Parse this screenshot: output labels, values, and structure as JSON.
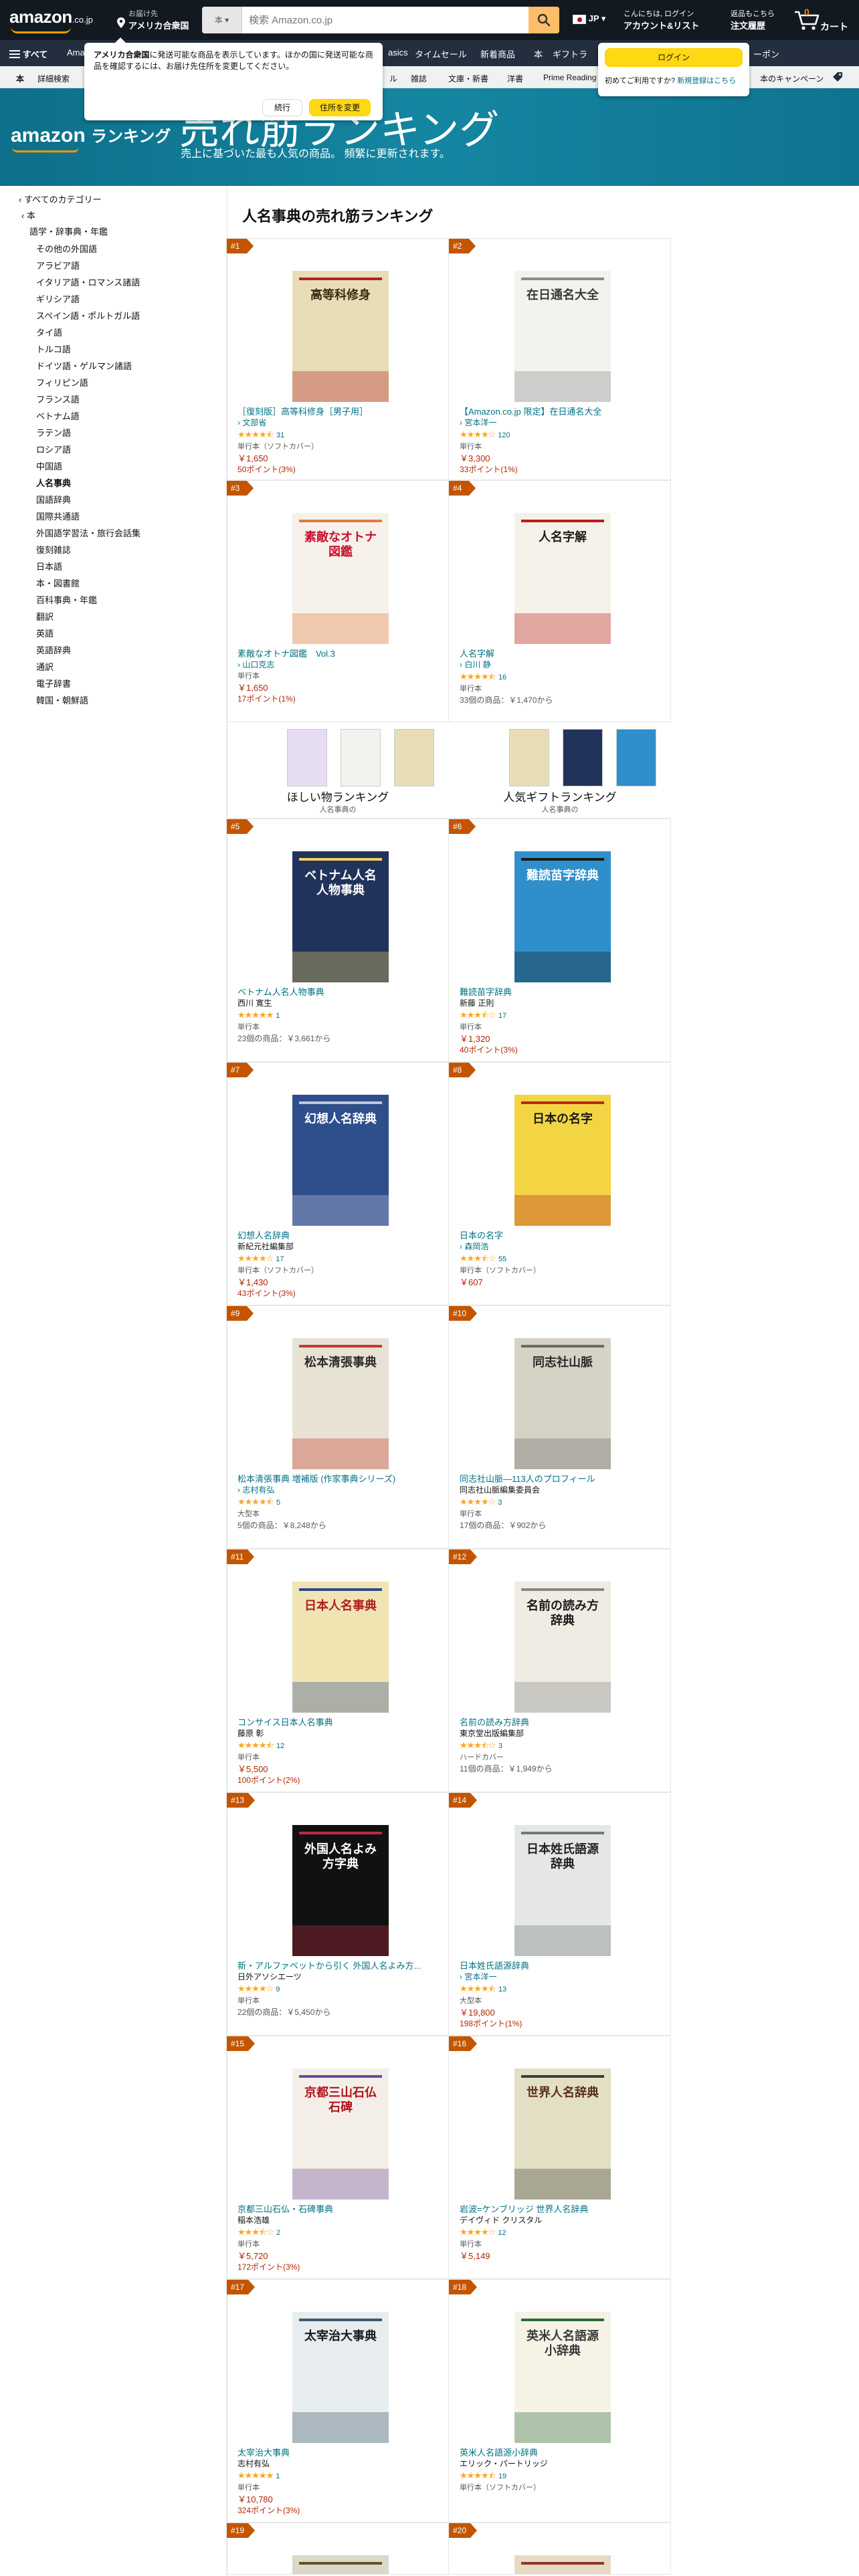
{
  "nav": {
    "logo_text": "amazon",
    "logo_tld": ".co.jp",
    "deliver_line1": "お届け先",
    "deliver_line2": "アメリカ合衆国",
    "search_category": "本",
    "search_placeholder": "検索 Amazon.co.jp",
    "lang": "JP",
    "account_line1": "こんにちは, ログイン",
    "account_line2": "アカウント&リスト",
    "orders_line1": "返品もこちら",
    "orders_line2": "注文履歴",
    "cart_count": "0",
    "cart_label": "カート"
  },
  "subnav": {
    "all": "すべて",
    "items": [
      "Amazon",
      "asics",
      "タイムセール",
      "新着商品",
      "本",
      "ギフトラ",
      "ーポン"
    ]
  },
  "thirdnav": {
    "items": [
      "本",
      "詳細検索",
      "ル",
      "雑誌",
      "文庫・新書",
      "洋書",
      "Prime Reading",
      "本のキャンペーン"
    ]
  },
  "popup": {
    "text_bold": "アメリカ合衆国",
    "text_rest": "に発送可能な商品を表示しています。ほかの国に発送可能な商品を確認するには、お届け先住所を変更してください。",
    "continue": "続行",
    "change": "住所を変更"
  },
  "signin": {
    "button": "ログイン",
    "prompt": "初めてご利用ですか?",
    "link": "新規登録はこちら"
  },
  "hero": {
    "brand": "amazon",
    "brand_rank": "ランキング",
    "title": "売れ筋ランキング",
    "subtitle": "売上に基づいた最も人気の商品。 頻繁に更新されます。"
  },
  "sidebar": {
    "all": "‹ すべてのカテゴリー",
    "parent": "‹ 本",
    "current": "語学・辞事典・年鑑",
    "categories": [
      "その他の外国語",
      "アラビア語",
      "イタリア語・ロマンス諸語",
      "ギリシア語",
      "スペイン語・ポルトガル語",
      "タイ語",
      "トルコ語",
      "ドイツ語・ゲルマン諸語",
      "フィリピン語",
      "フランス語",
      "ベトナム語",
      "ラテン語",
      "ロシア語",
      "中国語",
      "人名事典",
      "国語辞典",
      "国際共通語",
      "外国語学習法・旅行会話集",
      "復刻雑誌",
      "日本語",
      "本・図書館",
      "百科事典・年鑑",
      "翻訳",
      "英語",
      "英語辞典",
      "通訳",
      "電子辞書",
      "韓国・朝鮮語"
    ],
    "selected": "人名事典"
  },
  "main": {
    "title": "人名事典の売れ筋ランキング"
  },
  "promo": [
    {
      "label": "ほしい物ランキング",
      "sub": "人名事典の"
    },
    {
      "label": "人気ギフトランキング",
      "sub": "人名事典の"
    }
  ],
  "items": [
    {
      "rank": "#1",
      "title": "［復刻版］高等科修身［男子用］",
      "author": "文部省",
      "author_link": true,
      "stars": 4.5,
      "reviews": "31",
      "format": "単行本（ソフトカバー）",
      "price": "￥1,650",
      "offers": "",
      "points": "50ポイント(3%)"
    },
    {
      "rank": "#2",
      "title": "【Amazon.co.jp 限定】在日通名大全",
      "author": "宮本洋一",
      "author_link": true,
      "stars": 4,
      "reviews": "120",
      "format": "単行本",
      "price": "￥3,300",
      "offers": "",
      "points": "33ポイント(1%)"
    },
    {
      "rank": "#3",
      "title": "素敵なオトナ図鑑　Vol.3",
      "author": "山口克志",
      "author_link": true,
      "stars": 0,
      "reviews": "",
      "format": "単行本",
      "price": "￥1,650",
      "offers": "",
      "points": "17ポイント(1%)"
    },
    {
      "rank": "#4",
      "title": "人名字解",
      "author": "白川 静",
      "author_link": true,
      "stars": 4.5,
      "reviews": "16",
      "format": "単行本",
      "price": "",
      "offers": "33個の商品：￥1,470から",
      "points": ""
    },
    {
      "rank": "#5",
      "title": "ベトナム人名人物事典",
      "author": "西川 寛生",
      "author_link": false,
      "stars": 5,
      "reviews": "1",
      "format": "単行本",
      "price": "",
      "offers": "23個の商品：￥3,661から",
      "points": ""
    },
    {
      "rank": "#6",
      "title": "難読苗字辞典",
      "author": "新藤 正則",
      "author_link": false,
      "stars": 3.5,
      "reviews": "17",
      "format": "単行本",
      "price": "￥1,320",
      "offers": "",
      "points": "40ポイント(3%)"
    },
    {
      "rank": "#7",
      "title": "幻想人名辞典",
      "author": "新紀元社編集部",
      "author_link": false,
      "stars": 4,
      "reviews": "17",
      "format": "単行本（ソフトカバー）",
      "price": "￥1,430",
      "offers": "",
      "points": "43ポイント(3%)"
    },
    {
      "rank": "#8",
      "title": "日本の名字",
      "author": "森岡浩",
      "author_link": true,
      "stars": 3.5,
      "reviews": "55",
      "format": "単行本（ソフトカバー）",
      "price": "￥607",
      "offers": "",
      "points": ""
    },
    {
      "rank": "#9",
      "title": "松本清張事典 増補版 (作家事典シリーズ)",
      "author": "志村有弘",
      "author_link": true,
      "stars": 4.5,
      "reviews": "5",
      "format": "大型本",
      "price": "",
      "offers": "5個の商品：￥8,248から",
      "points": ""
    },
    {
      "rank": "#10",
      "title": "同志社山脈―113人のプロフィール",
      "author": "同志社山脈編集委員会",
      "author_link": false,
      "stars": 4,
      "reviews": "3",
      "format": "単行本",
      "price": "",
      "offers": "17個の商品：￥902から",
      "points": ""
    },
    {
      "rank": "#11",
      "title": "コンサイス日本人名事典",
      "author": "藤原 彰",
      "author_link": false,
      "stars": 4.5,
      "reviews": "12",
      "format": "単行本",
      "price": "￥5,500",
      "offers": "",
      "points": "100ポイント(2%)"
    },
    {
      "rank": "#12",
      "title": "名前の読み方辞典",
      "author": "東京堂出版編集部",
      "author_link": false,
      "stars": 3.5,
      "reviews": "3",
      "format": "ハードカバー",
      "price": "",
      "offers": "11個の商品：￥1,949から",
      "points": ""
    },
    {
      "rank": "#13",
      "title": "新・アルファベットから引く 外国人名よみ方...",
      "author": "日外アソシエーツ",
      "author_link": false,
      "stars": 4,
      "reviews": "9",
      "format": "単行本",
      "price": "",
      "offers": "22個の商品：￥5,450から",
      "points": ""
    },
    {
      "rank": "#14",
      "title": "日本姓氏語源辞典",
      "author": "宮本洋一",
      "author_link": true,
      "stars": 4.5,
      "reviews": "13",
      "format": "大型本",
      "price": "￥19,800",
      "offers": "",
      "points": "198ポイント(1%)"
    },
    {
      "rank": "#15",
      "title": "京都三山石仏・石碑事典",
      "author": "稲本浩雄",
      "author_link": false,
      "stars": 3.5,
      "reviews": "2",
      "format": "単行本",
      "price": "￥5,720",
      "offers": "",
      "points": "172ポイント(3%)"
    },
    {
      "rank": "#16",
      "title": "岩波=ケンブリッジ 世界人名辞典",
      "author": "デイヴィド クリスタル",
      "author_link": false,
      "stars": 4,
      "reviews": "12",
      "format": "単行本",
      "price": "￥5,149",
      "offers": "",
      "points": ""
    },
    {
      "rank": "#17",
      "title": "太宰治大事典",
      "author": "志村有弘",
      "author_link": false,
      "stars": 5,
      "reviews": "1",
      "format": "単行本",
      "price": "￥10,780",
      "offers": "",
      "points": "324ポイント(3%)"
    },
    {
      "rank": "#18",
      "title": "英米人名語源小辞典",
      "author": "エリック・パートリッジ",
      "author_link": false,
      "stars": 4.5,
      "reviews": "19",
      "format": "単行本（ソフトカバー）",
      "price": "",
      "offers": "",
      "points": ""
    },
    {
      "rank": "#19",
      "title": "",
      "author": "",
      "author_link": false,
      "stars": 0,
      "reviews": "",
      "format": "",
      "price": "",
      "offers": "",
      "points": ""
    },
    {
      "rank": "#20",
      "title": "",
      "author": "",
      "author_link": false,
      "stars": 0,
      "reviews": "",
      "format": "",
      "price": "",
      "offers": "",
      "points": ""
    }
  ],
  "covers": [
    {
      "text": "高等科修身",
      "bg": "#E9DDB7",
      "fg": "#3A2A12",
      "accent": "#B22222"
    },
    {
      "text": "在日通名大全",
      "bg": "#F4F2EE",
      "fg": "#3A3A3A",
      "accent": "#8A8A8A"
    },
    {
      "text": "素敵なオトナ図鑑",
      "bg": "#F6F1EA",
      "fg": "#C8102E",
      "accent": "#E27A3F"
    },
    {
      "text": "人名字解",
      "bg": "#F4F1E9",
      "fg": "#1D1D1D",
      "accent": "#C01B1B"
    },
    {
      "text": "ベトナム人名人物事典",
      "bg": "#22335B",
      "fg": "#FFFFFF",
      "accent": "#F2D15E"
    },
    {
      "text": "難読苗字辞典",
      "bg": "#2F8FCB",
      "fg": "#FFFFFF",
      "accent": "#1A1A1A"
    },
    {
      "text": "幻想人名辞典",
      "bg": "#2E4E8C",
      "fg": "#FFFFFF",
      "accent": "#C2C8D8"
    },
    {
      "text": "日本の名字",
      "bg": "#F3D544",
      "fg": "#1A1A1A",
      "accent": "#B5271F"
    },
    {
      "text": "松本清張事典",
      "bg": "#E8E2D4",
      "fg": "#2C2C2C",
      "accent": "#C23A2B"
    },
    {
      "text": "同志社山脈",
      "bg": "#D7D2C6",
      "fg": "#2A2A2A",
      "accent": "#6D6A64"
    },
    {
      "text": "日本人名事典",
      "bg": "#F1E4B3",
      "fg": "#B01E22",
      "accent": "#2A4C8C"
    },
    {
      "text": "名前の読み方辞典",
      "bg": "#EFECE3",
      "fg": "#1A1A1A",
      "accent": "#888"
    },
    {
      "text": "外国人名よみ方字典",
      "bg": "#111111",
      "fg": "#FFFFFF",
      "accent": "#C12A3F"
    },
    {
      "text": "日本姓氏語源辞典",
      "bg": "#E5E6E8",
      "fg": "#222222",
      "accent": "#6D7B76"
    },
    {
      "text": "京都三山石仏石碑",
      "bg": "#F3EFE8",
      "fg": "#B0121A",
      "accent": "#6D4B9A"
    },
    {
      "text": "世界人名辞典",
      "bg": "#E3DFC4",
      "fg": "#5A2F1C",
      "accent": "#3C3C3C"
    },
    {
      "text": "太宰治大事典",
      "bg": "#E7ECEF",
      "fg": "#1A1A1A",
      "accent": "#3C5A6A"
    },
    {
      "text": "英米人名語源小辞典",
      "bg": "#F5F3E6",
      "fg": "#3A3A3A",
      "accent": "#2E6B3A"
    },
    {
      "text": "",
      "bg": "#DCD8C8",
      "fg": "#333",
      "accent": "#6A4E2E"
    },
    {
      "text": "",
      "bg": "#E8D9C4",
      "fg": "#333",
      "accent": "#8A3A2A"
    }
  ],
  "colors": {
    "nav_bg": "#131921",
    "subnav_bg": "#232F3E",
    "accent": "#FF9900",
    "badge": "#C45500",
    "link": "#007185",
    "price": "#B12704",
    "star": "#FFA41C",
    "hero": "#1486A1"
  }
}
